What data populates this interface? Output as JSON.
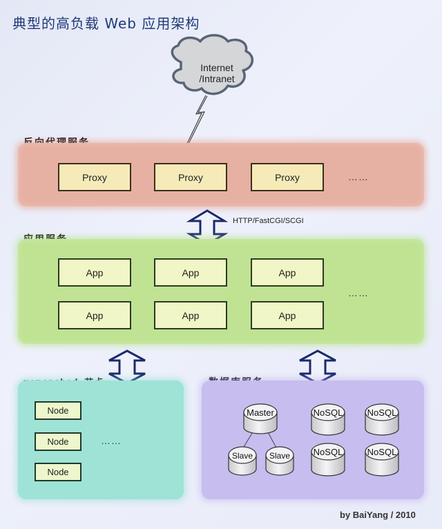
{
  "title": "典型的高负载 Web 应用架构",
  "cloud": {
    "line1": "Internet",
    "line2": "/Intranet"
  },
  "sections": {
    "proxy": {
      "label": "反向代理服务",
      "items": [
        "Proxy",
        "Proxy",
        "Proxy"
      ],
      "more": "……",
      "color": "#e6b0a2"
    },
    "app": {
      "label": "应用服务",
      "items": [
        "App",
        "App",
        "App",
        "App",
        "App",
        "App"
      ],
      "more": "……",
      "color": "#bfe393"
    },
    "cache": {
      "label": "memcached 节点",
      "items": [
        "Node",
        "Node",
        "Node"
      ],
      "more": "……",
      "color": "#9fe3d6"
    },
    "db": {
      "label": "数据库服务",
      "master": "Master",
      "slaves": [
        "Slave",
        "Slave"
      ],
      "nosql": [
        "NoSQL",
        "NoSQL",
        "NoSQL",
        "NoSQL"
      ],
      "color": "#c7bdee"
    }
  },
  "connections": {
    "proxy_to_app_protocol": "HTTP/FastCGI/SCGI"
  },
  "credit": "by BaiYang / 2010",
  "colors": {
    "arrow": "#1a2a6c",
    "title": "#1f3a78"
  }
}
